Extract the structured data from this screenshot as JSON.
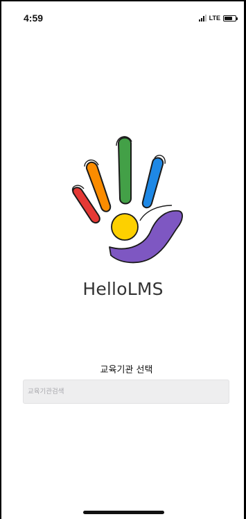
{
  "status_bar": {
    "time": "4:59",
    "network": "LTE",
    "icons": [
      "signal-icon",
      "battery-icon"
    ]
  },
  "app": {
    "name": "HelloLMS",
    "logo_icon": "hand-logo-icon"
  },
  "institution_select": {
    "title": "교육기관 선택",
    "search_placeholder": "교육기관검색",
    "search_value": ""
  },
  "colors": {
    "red": "#e53935",
    "orange": "#fb8c00",
    "green": "#43a047",
    "blue": "#1e88e5",
    "yellow": "#fdd000",
    "purple": "#7e57c2",
    "text": "#333333",
    "input_bg": "#eeeeef"
  }
}
